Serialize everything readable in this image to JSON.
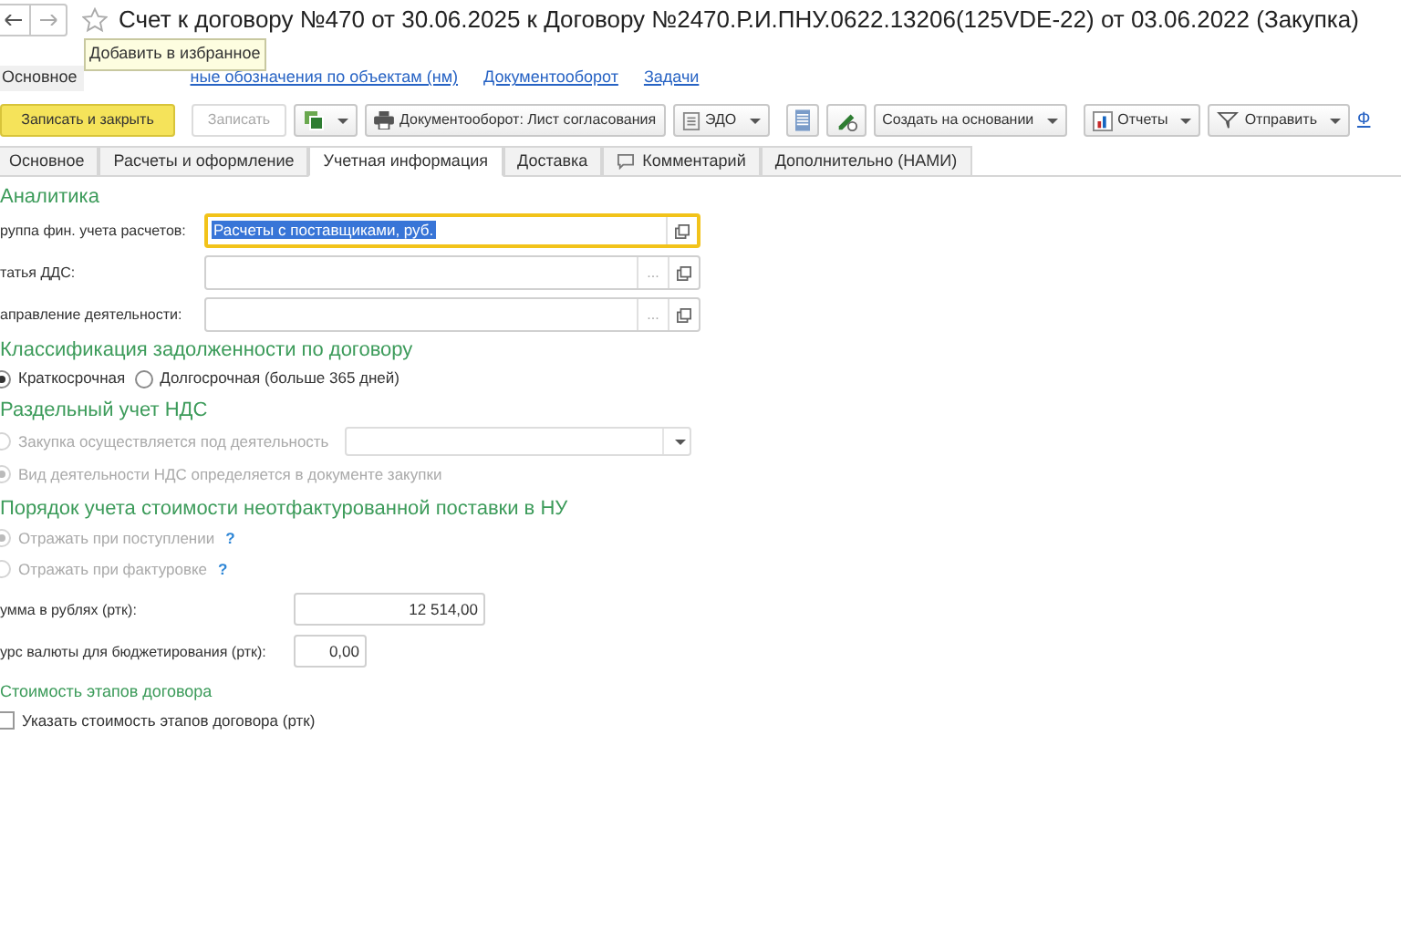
{
  "window": {
    "title": "Счет к договору №470 от 30.06.2025 к Договору №2470.Р.И.ПНУ.0622.13206(125VDE-22) от 03.06.2022 (Закупка)"
  },
  "tooltip": "Добавить в избранное",
  "nav_links": [
    {
      "label": "Основное",
      "selected": true
    },
    {
      "label": "ные обозначения по объектам (нм)",
      "selected": false
    },
    {
      "label": "Документооборот",
      "selected": false
    },
    {
      "label": "Задачи",
      "selected": false
    }
  ],
  "toolbar": [
    {
      "kind": "primary",
      "label": "Записать и закрыть",
      "disabled": false
    },
    {
      "kind": "text",
      "label": "Записать",
      "disabled": true
    },
    {
      "kind": "copy",
      "dropdown": true
    },
    {
      "kind": "print",
      "label": "Документооборот: Лист согласования"
    },
    {
      "kind": "edo",
      "label": "ЭДО",
      "dropdown": true
    },
    {
      "kind": "list"
    },
    {
      "kind": "pen"
    },
    {
      "kind": "text",
      "label": "Создать на основании",
      "dropdown": true,
      "disabled": false
    },
    {
      "kind": "reports",
      "label": "Отчеты",
      "dropdown": true
    },
    {
      "kind": "send",
      "label": "Отправить",
      "dropdown": true
    },
    {
      "kind": "link",
      "label": "Ф"
    }
  ],
  "tabs": [
    {
      "label": "Основное",
      "selected": false
    },
    {
      "label": "Расчеты и оформление",
      "selected": false
    },
    {
      "label": "Учетная информация",
      "selected": true
    },
    {
      "label": "Доставка",
      "selected": false
    },
    {
      "label": "Комментарий",
      "selected": false,
      "icon": true
    },
    {
      "label": "Дополнительно (НАМИ)",
      "selected": false
    }
  ],
  "analytics": {
    "heading": "Аналитика",
    "fields": [
      {
        "label": "руппа фин. учета расчетов:",
        "value": "Расчеты с поставщиками, руб.",
        "focused": true
      },
      {
        "label": "татья ДДС:",
        "focused": false,
        "ellipsis": "..."
      },
      {
        "label": "аправление деятельности:",
        "focused": false,
        "ellipsis": "..."
      }
    ]
  },
  "debt": {
    "heading": "Классификация задолженности по договору",
    "options": [
      {
        "label": "Краткосрочная",
        "selected": true
      },
      {
        "label": "Долгосрочная (больше 365 дней)",
        "selected": false
      }
    ]
  },
  "vat": {
    "heading": "Раздельный учет НДС",
    "options": [
      {
        "label": "Закупка осуществляется под деятельность",
        "selected": false,
        "disabled": true,
        "select": true
      },
      {
        "label": "Вид деятельности НДС определяется в документе закупки",
        "selected": true,
        "disabled": true,
        "select": false
      }
    ]
  },
  "tax": {
    "heading": "Порядок учета стоимости неотфактурованной поставки в НУ",
    "options": [
      {
        "label": "Отражать при поступлении",
        "selected": true,
        "disabled": true,
        "help": "?"
      },
      {
        "label": "Отражать при фактуровке",
        "selected": false,
        "disabled": true,
        "help": "?"
      }
    ]
  },
  "amounts": [
    {
      "label": "умма в рублях (ртк):",
      "value": "12 514,00",
      "wide": true
    },
    {
      "label": "урс валюты для бюджетирования (ртк):",
      "value": "0,00",
      "wide": false
    }
  ],
  "stages": {
    "heading": "Стоимость этапов договора",
    "checkbox": {
      "label": "Указать стоимость этапов договора (ртк)",
      "checked": false
    }
  }
}
